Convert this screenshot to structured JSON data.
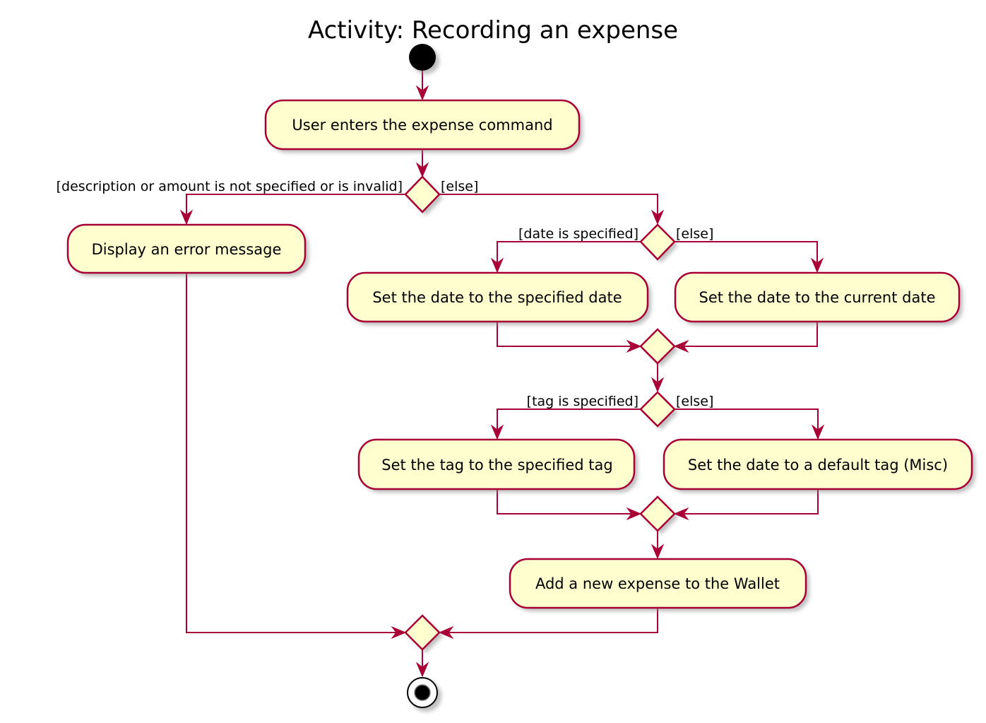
{
  "diagram": {
    "title": "Activity: Recording an expense",
    "colors": {
      "line": "#A80036",
      "activity_fill": "#FEFECE",
      "node_fill": "#000000",
      "background": "#FFFFFF"
    },
    "nodes": {
      "start": {
        "type": "start"
      },
      "enter_command": {
        "type": "activity",
        "label": "User enters the expense command"
      },
      "decision_valid": {
        "type": "decision"
      },
      "display_error": {
        "type": "activity",
        "label": "Display an error message"
      },
      "decision_date": {
        "type": "decision"
      },
      "set_specified_date": {
        "type": "activity",
        "label": "Set the date to the specified date"
      },
      "set_current_date": {
        "type": "activity",
        "label": "Set the date to the current date"
      },
      "merge_date": {
        "type": "merge"
      },
      "decision_tag": {
        "type": "decision"
      },
      "set_specified_tag": {
        "type": "activity",
        "label": "Set the tag to the specified tag"
      },
      "set_default_tag": {
        "type": "activity",
        "label": "Set the date to a default tag (Misc)"
      },
      "merge_tag": {
        "type": "merge"
      },
      "add_expense": {
        "type": "activity",
        "label": "Add a new expense to the Wallet"
      },
      "merge_final": {
        "type": "merge"
      },
      "end": {
        "type": "end"
      }
    },
    "guards": {
      "invalid": "[description or amount is not specified or is invalid]",
      "valid_else": "[else]",
      "date_specified": "[date is specified]",
      "date_else": "[else]",
      "tag_specified": "[tag is specified]",
      "tag_else": "[else]"
    },
    "edges": [
      {
        "from": "start",
        "to": "enter_command"
      },
      {
        "from": "enter_command",
        "to": "decision_valid"
      },
      {
        "from": "decision_valid",
        "to": "display_error",
        "guard": "[description or amount is not specified or is invalid]"
      },
      {
        "from": "decision_valid",
        "to": "decision_date",
        "guard": "[else]"
      },
      {
        "from": "decision_date",
        "to": "set_specified_date",
        "guard": "[date is specified]"
      },
      {
        "from": "decision_date",
        "to": "set_current_date",
        "guard": "[else]"
      },
      {
        "from": "set_specified_date",
        "to": "merge_date"
      },
      {
        "from": "set_current_date",
        "to": "merge_date"
      },
      {
        "from": "merge_date",
        "to": "decision_tag"
      },
      {
        "from": "decision_tag",
        "to": "set_specified_tag",
        "guard": "[tag is specified]"
      },
      {
        "from": "decision_tag",
        "to": "set_default_tag",
        "guard": "[else]"
      },
      {
        "from": "set_specified_tag",
        "to": "merge_tag"
      },
      {
        "from": "set_default_tag",
        "to": "merge_tag"
      },
      {
        "from": "merge_tag",
        "to": "add_expense"
      },
      {
        "from": "display_error",
        "to": "merge_final"
      },
      {
        "from": "add_expense",
        "to": "merge_final"
      },
      {
        "from": "merge_final",
        "to": "end"
      }
    ]
  }
}
